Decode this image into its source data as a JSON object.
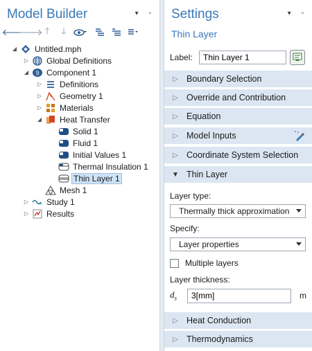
{
  "model_builder": {
    "title": "Model Builder",
    "tree": [
      {
        "label": "Untitled.mph",
        "icon": "model-file-icon"
      },
      {
        "label": "Global Definitions",
        "icon": "globe-icon"
      },
      {
        "label": "Component 1",
        "icon": "component-icon"
      },
      {
        "label": "Definitions",
        "icon": "definitions-icon"
      },
      {
        "label": "Geometry 1",
        "icon": "geometry-icon"
      },
      {
        "label": "Materials",
        "icon": "materials-icon"
      },
      {
        "label": "Heat Transfer",
        "icon": "heat-transfer-icon"
      },
      {
        "label": "Solid 1",
        "icon": "domain-node-icon"
      },
      {
        "label": "Fluid 1",
        "icon": "domain-node-icon"
      },
      {
        "label": "Initial Values 1",
        "icon": "domain-node-icon"
      },
      {
        "label": "Thermal Insulation 1",
        "icon": "boundary-node-icon"
      },
      {
        "label": "Thin Layer 1",
        "icon": "boundary-node-icon"
      },
      {
        "label": "Mesh 1",
        "icon": "mesh-icon"
      },
      {
        "label": "Study 1",
        "icon": "study-icon"
      },
      {
        "label": "Results",
        "icon": "results-icon"
      }
    ]
  },
  "settings": {
    "title": "Settings",
    "subtitle": "Thin Layer",
    "label_caption": "Label:",
    "label_value": "Thin Layer 1",
    "sections": {
      "boundary_selection": "Boundary Selection",
      "override": "Override and Contribution",
      "equation": "Equation",
      "model_inputs": "Model Inputs",
      "coordinate_system": "Coordinate System Selection",
      "thin_layer": "Thin Layer",
      "heat_conduction": "Heat Conduction",
      "thermodynamics": "Thermodynamics"
    },
    "layer_type_label": "Layer type:",
    "layer_type_value": "Thermally thick approximation",
    "specify_label": "Specify:",
    "specify_value": "Layer properties",
    "multiple_layers_label": "Multiple layers",
    "multiple_layers_checked": false,
    "thickness_label": "Layer thickness:",
    "thickness_symbol": "d",
    "thickness_symbol_sub": "s",
    "thickness_value": "3[mm]",
    "thickness_unit": "m"
  },
  "colors": {
    "accent": "#3a79b8",
    "section_bg": "#dbe6f2",
    "selection_bg": "#cfe3f7"
  }
}
